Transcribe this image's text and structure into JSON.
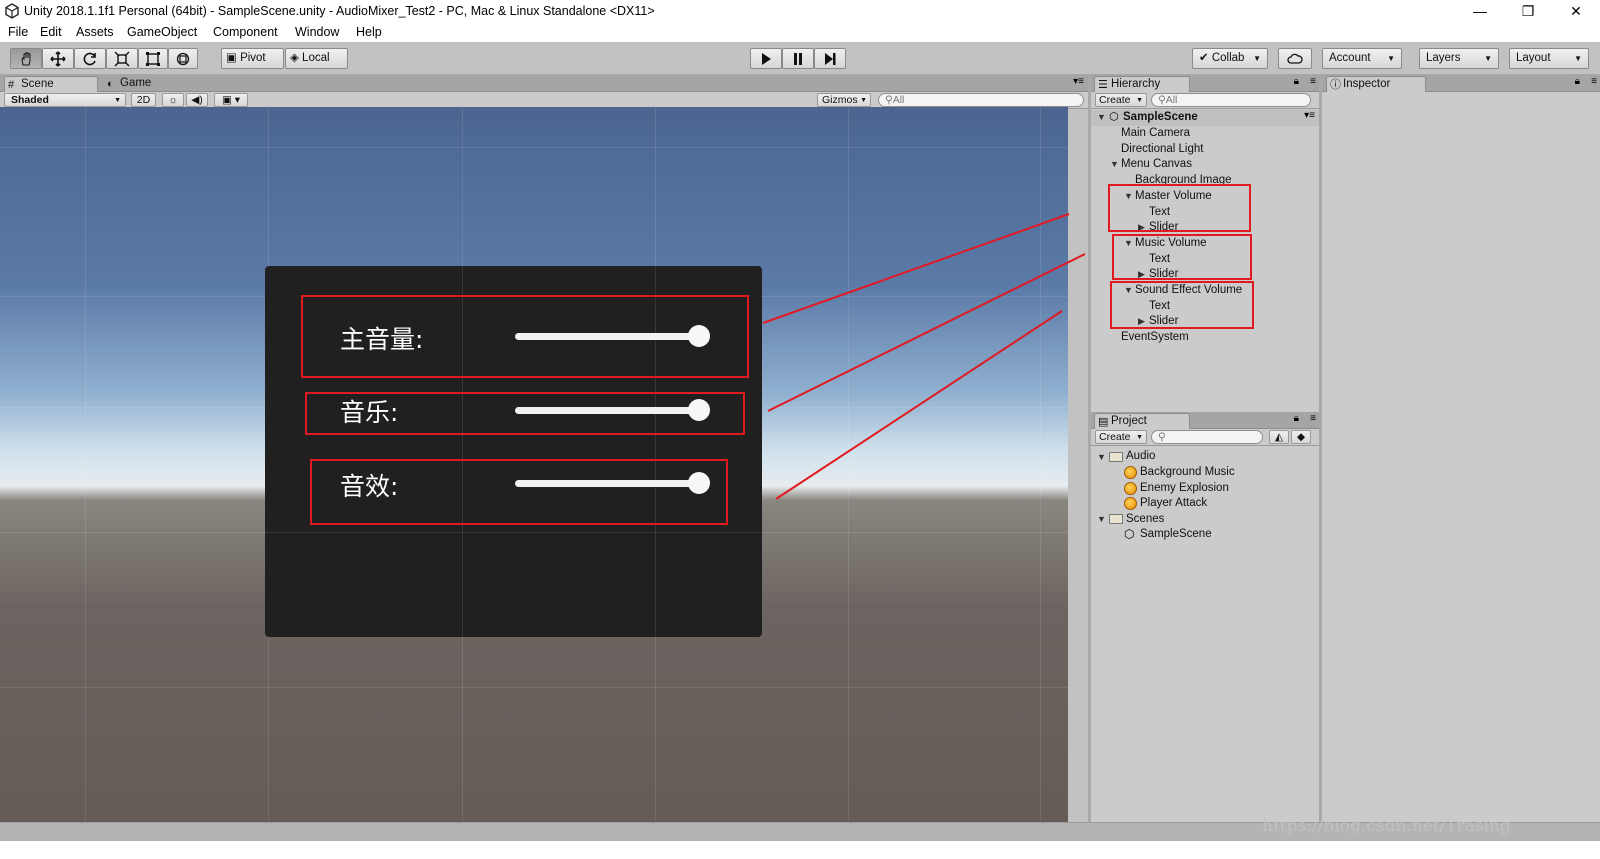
{
  "window": {
    "title": "Unity 2018.1.1f1 Personal (64bit) - SampleScene.unity - AudioMixer_Test2 - PC, Mac & Linux Standalone <DX11>",
    "minimize_glyph": "—",
    "restore_glyph": "❐",
    "close_glyph": "✕"
  },
  "menu": [
    "File",
    "Edit",
    "Assets",
    "GameObject",
    "Component",
    "Window",
    "Help"
  ],
  "toolbar": {
    "tools": [
      "hand-icon",
      "move-icon",
      "rotate-icon",
      "scale-icon",
      "rect-icon",
      "transform-icon"
    ],
    "pivot_label": "Pivot",
    "local_label": "Local",
    "collab_label": "Collab",
    "account_label": "Account",
    "layers_label": "Layers",
    "layout_label": "Layout"
  },
  "scene_panel": {
    "tabs": [
      "Scene",
      "Game"
    ],
    "shading_mode": "Shaded",
    "mode_2d": "2D",
    "gizmos_label": "Gizmos",
    "search_placeholder": "All"
  },
  "game_ui": {
    "rows": [
      {
        "label": "主音量:",
        "slider_value": 1.0
      },
      {
        "label": "音乐:",
        "slider_value": 1.0
      },
      {
        "label": "音效:",
        "slider_value": 1.0
      }
    ]
  },
  "hierarchy": {
    "tab": "Hierarchy",
    "create_label": "Create",
    "search_placeholder": "All",
    "scene_name": "SampleScene",
    "items": [
      {
        "label": "Main Camera"
      },
      {
        "label": "Directional Light"
      },
      {
        "label": "Menu Canvas"
      },
      {
        "label": "Background Image"
      },
      {
        "label": "Master Volume"
      },
      {
        "label": "Text"
      },
      {
        "label": "Slider"
      },
      {
        "label": "Music Volume"
      },
      {
        "label": "Text"
      },
      {
        "label": "Slider"
      },
      {
        "label": "Sound Effect Volume"
      },
      {
        "label": "Text"
      },
      {
        "label": "Slider"
      },
      {
        "label": "EventSystem"
      }
    ]
  },
  "inspector": {
    "tab": "Inspector"
  },
  "project": {
    "tab": "Project",
    "create_label": "Create",
    "items": [
      {
        "label": "Audio",
        "kind": "folder"
      },
      {
        "label": "Background Music",
        "kind": "audio"
      },
      {
        "label": "Enemy Explosion",
        "kind": "audio"
      },
      {
        "label": "Player Attack",
        "kind": "audio"
      },
      {
        "label": "Scenes",
        "kind": "folder"
      },
      {
        "label": "SampleScene",
        "kind": "scene"
      }
    ]
  },
  "watermark": "https://blog.csdn.net/Trasing",
  "colors": {
    "annotation_red": "#e11a22",
    "panel_dark": "#202020"
  }
}
